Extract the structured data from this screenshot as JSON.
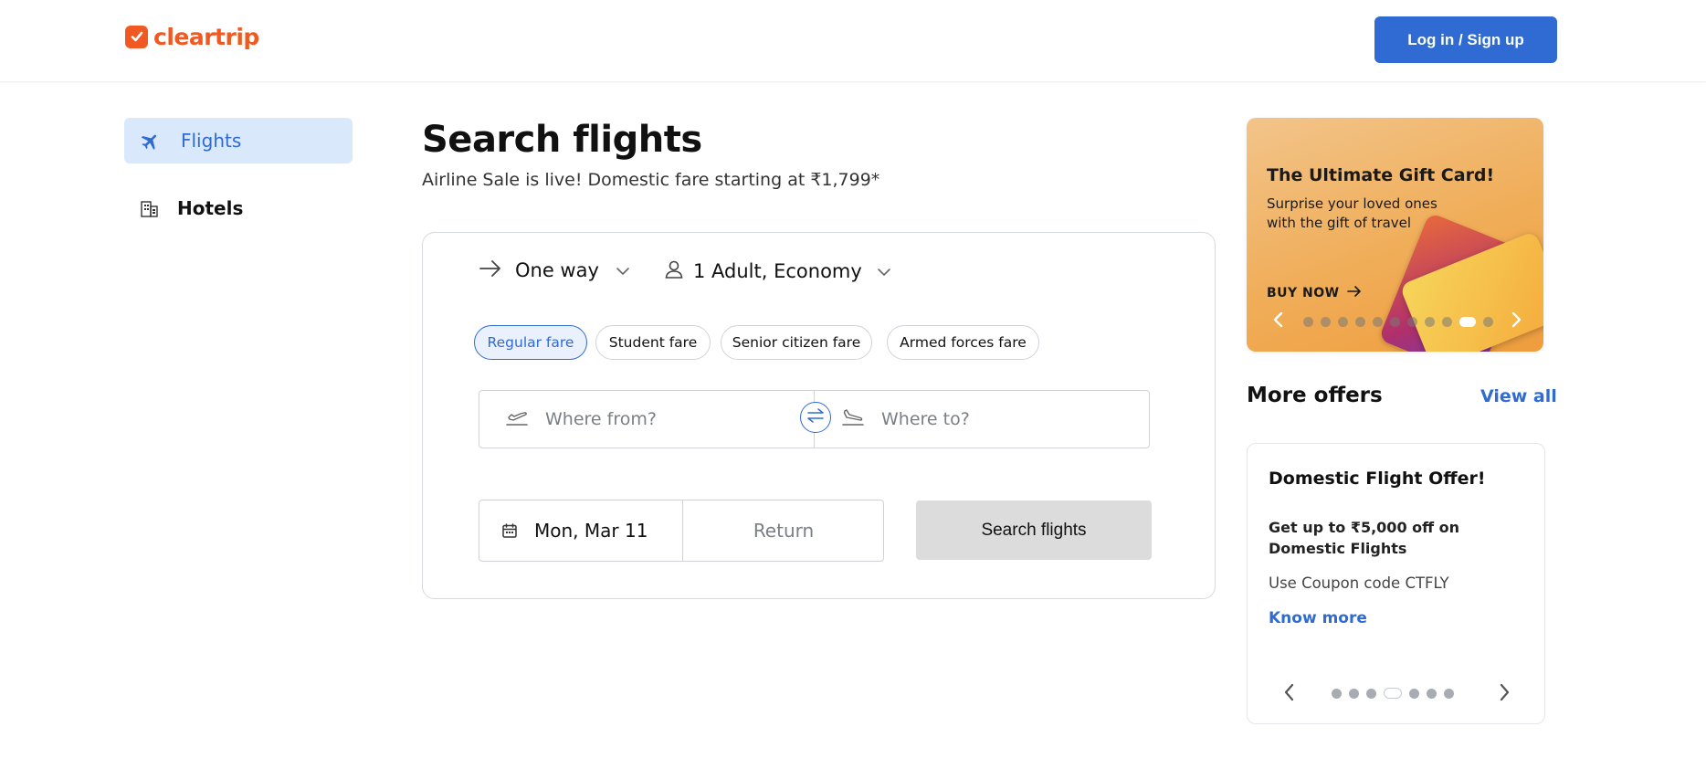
{
  "header": {
    "logo_text": "cleartrip",
    "login_label": "Log in / Sign up"
  },
  "sidebar": {
    "items": [
      {
        "label": "Flights",
        "icon": "plane-icon",
        "active": true
      },
      {
        "label": "Hotels",
        "icon": "building-icon",
        "active": false
      }
    ]
  },
  "main": {
    "title": "Search flights",
    "subtitle": "Airline Sale is live! Domestic fare starting at ₹1,799*",
    "trip_type": "One way",
    "travellers": "1 Adult, Economy",
    "fares": [
      {
        "label": "Regular fare",
        "active": true
      },
      {
        "label": "Student fare",
        "active": false
      },
      {
        "label": "Senior citizen fare",
        "active": false
      },
      {
        "label": "Armed forces fare",
        "active": false
      }
    ],
    "from_placeholder": "Where from?",
    "to_placeholder": "Where to?",
    "depart_date": "Mon, Mar 11",
    "return_placeholder": "Return",
    "search_label": "Search flights"
  },
  "banner": {
    "title": "The Ultimate Gift Card!",
    "subtitle": "Surprise your loved ones with the gift of travel",
    "cta": "BUY NOW",
    "slide_count": 11,
    "active_slide": 10
  },
  "offers": {
    "title": "More offers",
    "view_all": "View all",
    "card": {
      "title": "Domestic Flight Offer!",
      "description": "Get up to ₹5,000 off on Domestic Flights",
      "coupon": "Use Coupon code CTFLY",
      "link": "Know more"
    },
    "slide_count": 7,
    "active_slide": 4
  },
  "colors": {
    "brand": "#f05a22",
    "accent": "#2f6bd2",
    "active_bg": "#d9e8fb"
  }
}
